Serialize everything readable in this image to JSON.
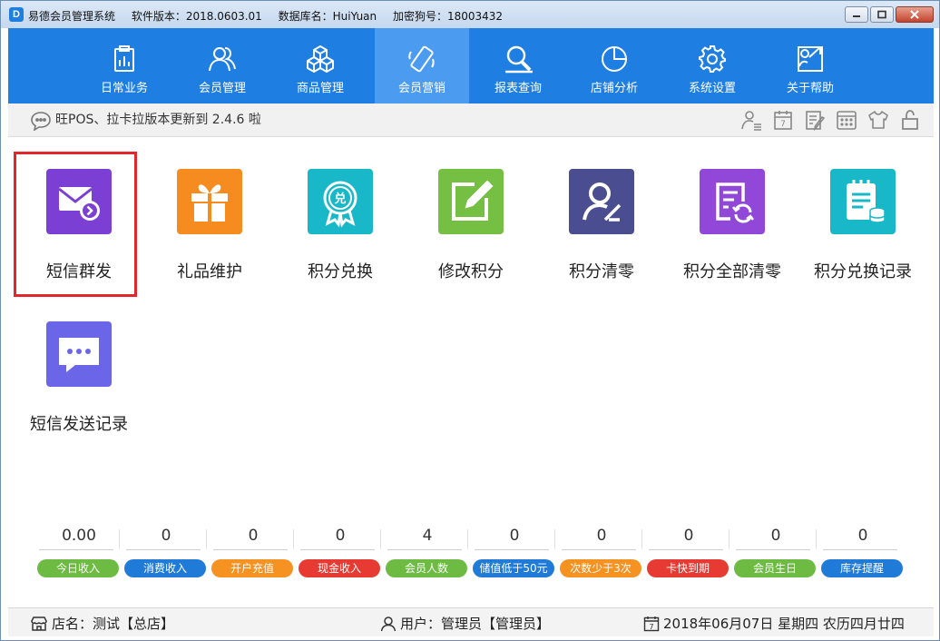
{
  "window": {
    "app_name": "易德会员管理系统",
    "version": "软件版本：2018.0603.01",
    "database": "数据库名：HuiYuan",
    "dongle": "加密狗号：18003432",
    "app_icon_letter": "D"
  },
  "nav": {
    "items": [
      {
        "label": "日常业务",
        "icon": "clipboard-icon"
      },
      {
        "label": "会员管理",
        "icon": "users-icon"
      },
      {
        "label": "商品管理",
        "icon": "boxes-icon"
      },
      {
        "label": "会员营销",
        "icon": "phone-icon",
        "active": true
      },
      {
        "label": "报表查询",
        "icon": "report-search-icon"
      },
      {
        "label": "店铺分析",
        "icon": "pie-chart-icon"
      },
      {
        "label": "系统设置",
        "icon": "gear-icon"
      },
      {
        "label": "关于帮助",
        "icon": "help-icon"
      }
    ],
    "bg_color": "#1e7ee2",
    "active_color": "#4b9cf0"
  },
  "notice": {
    "text": "旺POS、拉卡拉版本更新到 2.4.6 啦",
    "tools": [
      "user-switch-icon",
      "calendar-icon",
      "notepad-edit-icon",
      "calculator-icon",
      "shirt-icon",
      "lock-icon"
    ]
  },
  "tiles": [
    {
      "label": "短信群发",
      "color": "#7b3fd3",
      "icon": "sms-mail-icon",
      "selected": true
    },
    {
      "label": "礼品维护",
      "color": "#f68b1f",
      "icon": "gift-icon"
    },
    {
      "label": "积分兑换",
      "color": "#19b8c8",
      "icon": "exchange-badge-icon"
    },
    {
      "label": "修改积分",
      "color": "#75c043",
      "icon": "edit-icon"
    },
    {
      "label": "积分清零",
      "color": "#4a4d8f",
      "icon": "user-clear-icon"
    },
    {
      "label": "积分全部清零",
      "color": "#9147d8",
      "icon": "document-refresh-icon"
    },
    {
      "label": "积分兑换记录",
      "color": "#19b8c8",
      "icon": "notebook-db-icon"
    },
    {
      "label": "短信发送记录",
      "color": "#6b66e8",
      "icon": "chat-bubble-icon"
    }
  ],
  "stats": [
    {
      "value": "0.00",
      "label": "今日收入",
      "color": "#6dbb43"
    },
    {
      "value": "0",
      "label": "消费收入",
      "color": "#1f7ad8"
    },
    {
      "value": "0",
      "label": "开户充值",
      "color": "#f69221"
    },
    {
      "value": "0",
      "label": "现金收入",
      "color": "#e63a32"
    },
    {
      "value": "4",
      "label": "会员人数",
      "color": "#6dbb43"
    },
    {
      "value": "0",
      "label": "储值低于50元",
      "color": "#1f7ad8"
    },
    {
      "value": "0",
      "label": "次数少于3次",
      "color": "#f69221"
    },
    {
      "value": "0",
      "label": "卡快到期",
      "color": "#e63a32"
    },
    {
      "value": "0",
      "label": "会员生日",
      "color": "#6dbb43"
    },
    {
      "value": "0",
      "label": "库存提醒",
      "color": "#1f7ad8"
    }
  ],
  "status": {
    "store": "店名：测试【总店】",
    "user": "用户：管理员【管理员】",
    "date": "2018年06月07日 星期四 农历四月廿四"
  }
}
